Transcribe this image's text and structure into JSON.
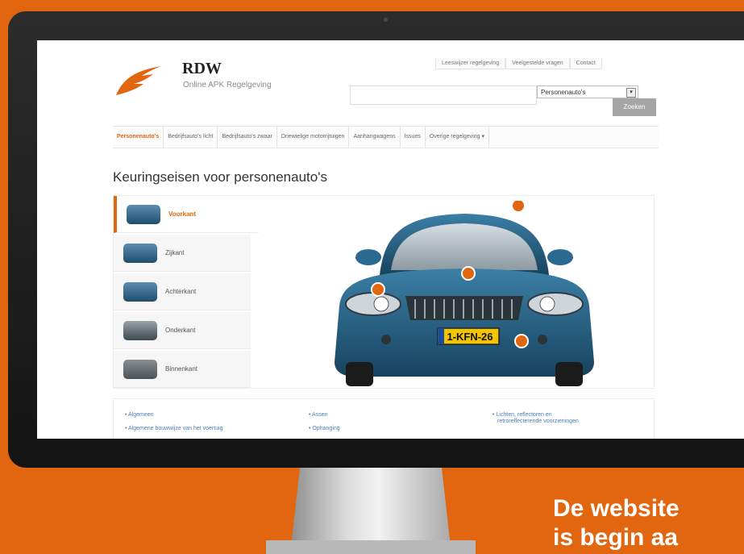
{
  "header": {
    "brand": "RDW",
    "tagline": "Online APK Regelgeving",
    "top_links": [
      "Leeswijzer regelgeving",
      "Veelgestelde vragen",
      "Contact"
    ]
  },
  "search": {
    "placeholder": "",
    "category_selected": "Personenauto's",
    "button_label": "Zoeken"
  },
  "nav": {
    "items": [
      {
        "label": "Personenauto's",
        "active": true
      },
      {
        "label": "Bedrijfsauto's licht",
        "active": false
      },
      {
        "label": "Bedrijfsauto's zwaar",
        "active": false
      },
      {
        "label": "Driewielige motorrijtuigen",
        "active": false
      },
      {
        "label": "Aanhangwagens",
        "active": false
      },
      {
        "label": "Issues",
        "active": false
      },
      {
        "label": "Overige regelgeving",
        "active": false
      }
    ]
  },
  "main": {
    "title": "Keuringseisen voor personenauto's",
    "views": [
      {
        "label": "Voorkant",
        "active": true
      },
      {
        "label": "Zijkant",
        "active": false
      },
      {
        "label": "Achterkant",
        "active": false
      },
      {
        "label": "Onderkant",
        "active": false
      },
      {
        "label": "Binnenkant",
        "active": false
      }
    ],
    "license_plate": "1-KFN-26"
  },
  "links": {
    "col1": [
      "Algemeen",
      "Algemene bouwwijze van het voertuig"
    ],
    "col2": [
      "Assen",
      "Ophanging"
    ],
    "col3": [
      "Lichten, reflectoren en",
      "retroreflecterende voorzieningen"
    ]
  },
  "caption": {
    "line1": "De website",
    "line2": "is begin aa"
  },
  "colors": {
    "background": "#e2660f",
    "accent": "#e2660f",
    "car": "#1f5a7e",
    "hotspot": "#e2660f"
  }
}
